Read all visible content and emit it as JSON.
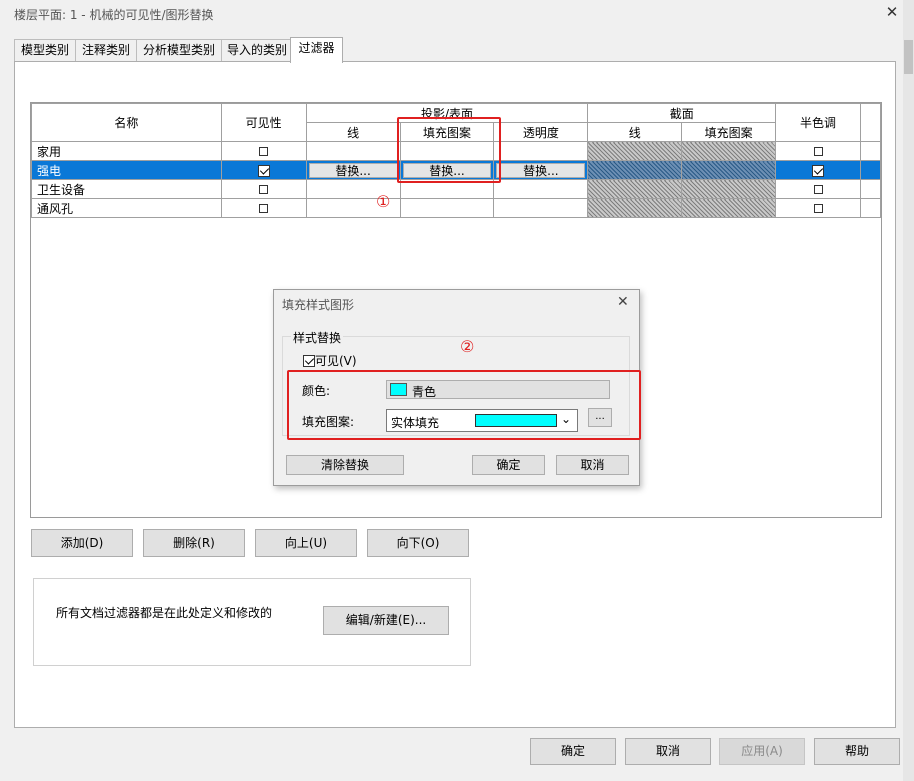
{
  "window": {
    "title": "楼层平面: 1 - 机械的可见性/图形替换"
  },
  "tabs": [
    {
      "label": "模型类别"
    },
    {
      "label": "注释类别"
    },
    {
      "label": "分析模型类别"
    },
    {
      "label": "导入的类别"
    },
    {
      "label": "过滤器"
    }
  ],
  "table": {
    "headers": {
      "name": "名称",
      "visibility": "可见性",
      "projection": "投影/表面",
      "line": "线",
      "fill_pattern": "填充图案",
      "transparency": "透明度",
      "cut": "截面",
      "cut_line": "线",
      "cut_fill_pattern": "填充图案",
      "halftone": "半色调"
    },
    "override_label": "替换...",
    "rows": [
      {
        "name": "家用",
        "visible": false,
        "halftone": false,
        "selected": false
      },
      {
        "name": "强电",
        "visible": true,
        "halftone": false,
        "selected": true
      },
      {
        "name": "卫生设备",
        "visible": false,
        "halftone": false,
        "selected": false
      },
      {
        "name": "通风孔",
        "visible": false,
        "halftone": false,
        "selected": false
      }
    ]
  },
  "annotations": {
    "one": "①",
    "two": "②",
    "color": "#e02020"
  },
  "dialog": {
    "title": "填充样式图形",
    "group": "样式替换",
    "visible_label": "可见(V)",
    "visible_checked": true,
    "color_label": "颜色:",
    "color_value": "青色",
    "color_hex": "#00ffff",
    "fill_label": "填充图案:",
    "fill_value": "实体填充",
    "more_label": "...",
    "clear_label": "清除替换",
    "ok_label": "确定",
    "cancel_label": "取消"
  },
  "row_buttons": {
    "add": "添加(D)",
    "delete": "删除(R)",
    "up": "向上(U)",
    "down": "向下(O)"
  },
  "info": {
    "text": "所有文档过滤器都是在此处定义和修改的",
    "edit_label": "编辑/新建(E)..."
  },
  "footer": {
    "ok": "确定",
    "cancel": "取消",
    "apply": "应用(A)",
    "help": "帮助"
  },
  "colors": {
    "selection": "#0a78d7",
    "cyan": "#00ffff"
  }
}
